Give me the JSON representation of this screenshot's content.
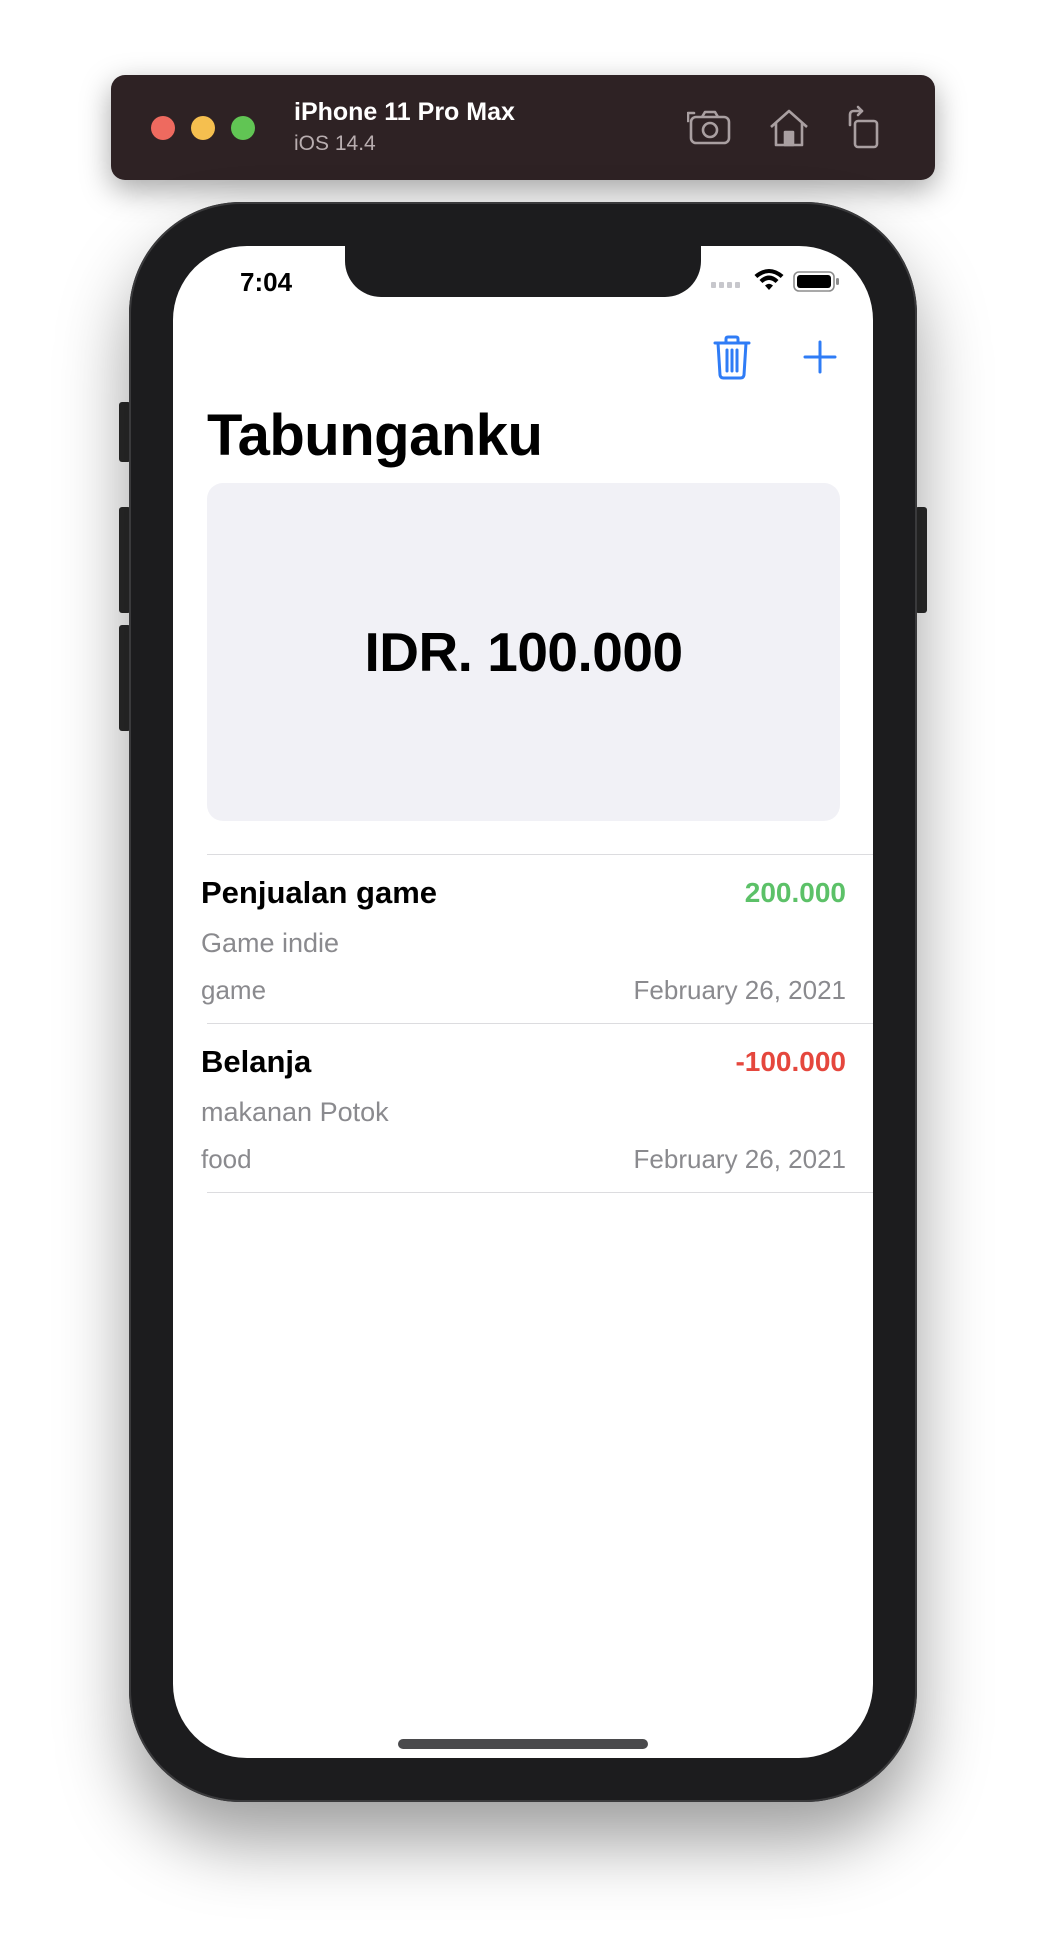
{
  "simulator": {
    "device_name": "iPhone 11 Pro Max",
    "os_version": "iOS 14.4",
    "icons": [
      "screenshot-icon",
      "home-icon",
      "rotate-icon"
    ]
  },
  "status_bar": {
    "time": "7:04",
    "icons": [
      "cellular-icon",
      "wifi-icon",
      "battery-icon"
    ]
  },
  "nav": {
    "title": "Tabunganku",
    "actions": [
      "trash-icon",
      "plus-icon"
    ],
    "accent_color": "#2f7cf6"
  },
  "balance": {
    "text": "IDR. 100.000"
  },
  "transactions": [
    {
      "title": "Penjualan game",
      "amount": "200.000",
      "amount_color": "#5cc168",
      "description": "Game indie",
      "category": "game",
      "date": "February 26, 2021"
    },
    {
      "title": "Belanja",
      "amount": "-100.000",
      "amount_color": "#e5473d",
      "description": "makanan Potok",
      "category": "food",
      "date": "February 26, 2021"
    }
  ]
}
